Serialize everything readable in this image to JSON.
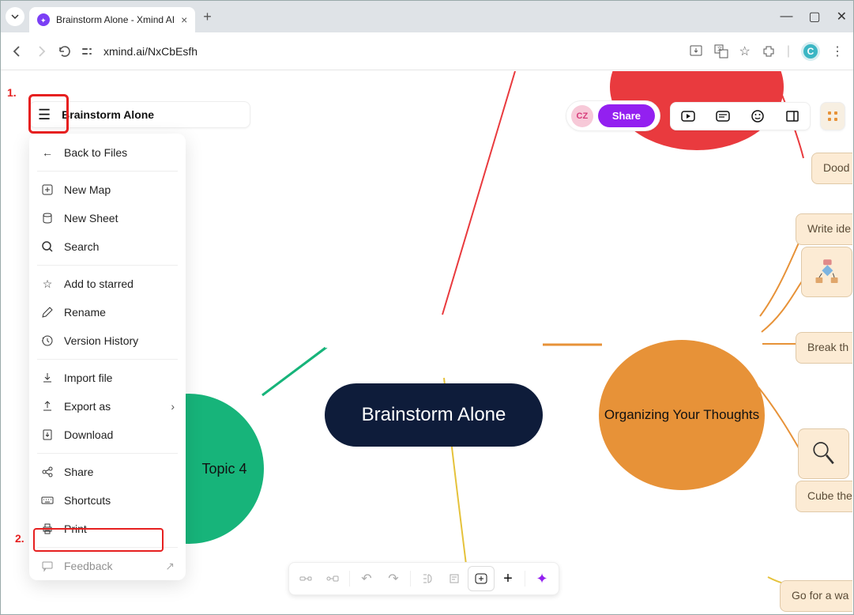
{
  "browser": {
    "tab_title": "Brainstorm Alone - Xmind AI",
    "url": "xmind.ai/NxCbEsfh",
    "profile_letter": "C"
  },
  "annotations": {
    "one": "1.",
    "two": "2."
  },
  "header": {
    "title": "Brainstorm Alone",
    "user_initials": "CZ",
    "share_label": "Share"
  },
  "menu": {
    "back": "Back to Files",
    "new_map": "New Map",
    "new_sheet": "New Sheet",
    "search": "Search",
    "starred": "Add to starred",
    "rename": "Rename",
    "version": "Version History",
    "import": "Import file",
    "export": "Export as",
    "download": "Download",
    "share": "Share",
    "shortcuts": "Shortcuts",
    "print": "Print",
    "feedback": "Feedback"
  },
  "mindmap": {
    "center": "Brainstorm Alone",
    "orange": "Organizing Your Thoughts",
    "green": "Topic 4",
    "branches": {
      "doodle": "Dood",
      "write": "Write ide",
      "break": "Break th",
      "cube": "Cube the",
      "walk": "Go for a wa"
    }
  }
}
